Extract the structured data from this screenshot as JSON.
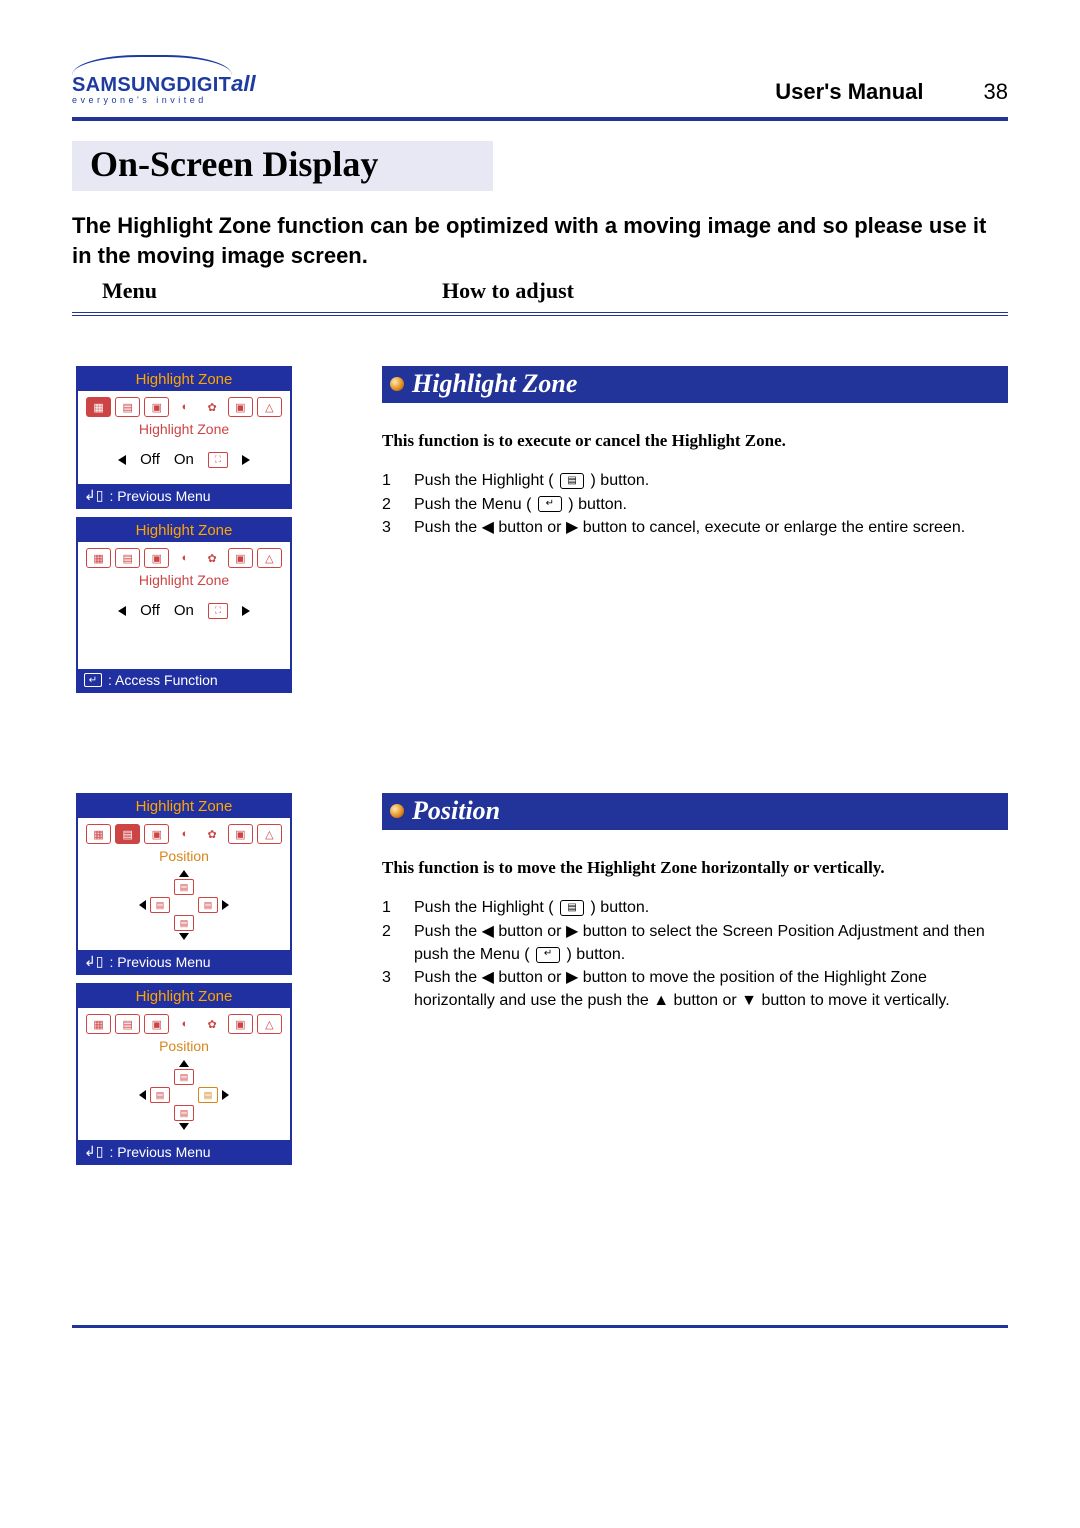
{
  "header": {
    "brand_samsung": "SAMSUNG ",
    "brand_digit": "DIGIT",
    "brand_all": "all",
    "brand_tag": "everyone's invited",
    "manual": "User's Manual",
    "page": "38"
  },
  "title": "On-Screen Display",
  "intro": "The Highlight Zone function can be optimized with a moving image and so please use it in the moving image screen.",
  "columns": {
    "menu": "Menu",
    "adjust": "How to adjust"
  },
  "sec1": {
    "title": "Highlight Zone",
    "desc": "This function is to execute or cancel the Highlight Zone.",
    "steps": [
      {
        "n": "1",
        "pre": "Push the Highlight ( ",
        "post": " ) button."
      },
      {
        "n": "2",
        "pre": "Push the Menu ( ",
        "post": " ) button."
      },
      {
        "n": "3",
        "txt": "Push the ◀ button or ▶ button to cancel, execute or enlarge the entire screen."
      }
    ],
    "osd": {
      "title": "Highlight Zone",
      "sub": "Highlight Zone",
      "off": "Off",
      "on": "On",
      "foot1": ": Previous Menu",
      "foot2": ": Access Function"
    }
  },
  "sec2": {
    "title": "Position",
    "desc": "This function is to move the Highlight Zone horizontally or vertically.",
    "steps": [
      {
        "n": "1",
        "pre": "Push the Highlight ( ",
        "post": " ) button."
      },
      {
        "n": "2",
        "pre": "Push the ◀ button or ▶ button to select the Screen Position Adjustment and then push the Menu ( ",
        "post": " ) button."
      },
      {
        "n": "3",
        "txt": "Push the ◀ button or ▶ button to move the position of the Highlight Zone horizontally and use the push the ▲ button or ▼ button to move it vertically."
      }
    ],
    "osd": {
      "title": "Highlight Zone",
      "sub": "Position",
      "foot": ": Previous Menu"
    }
  }
}
